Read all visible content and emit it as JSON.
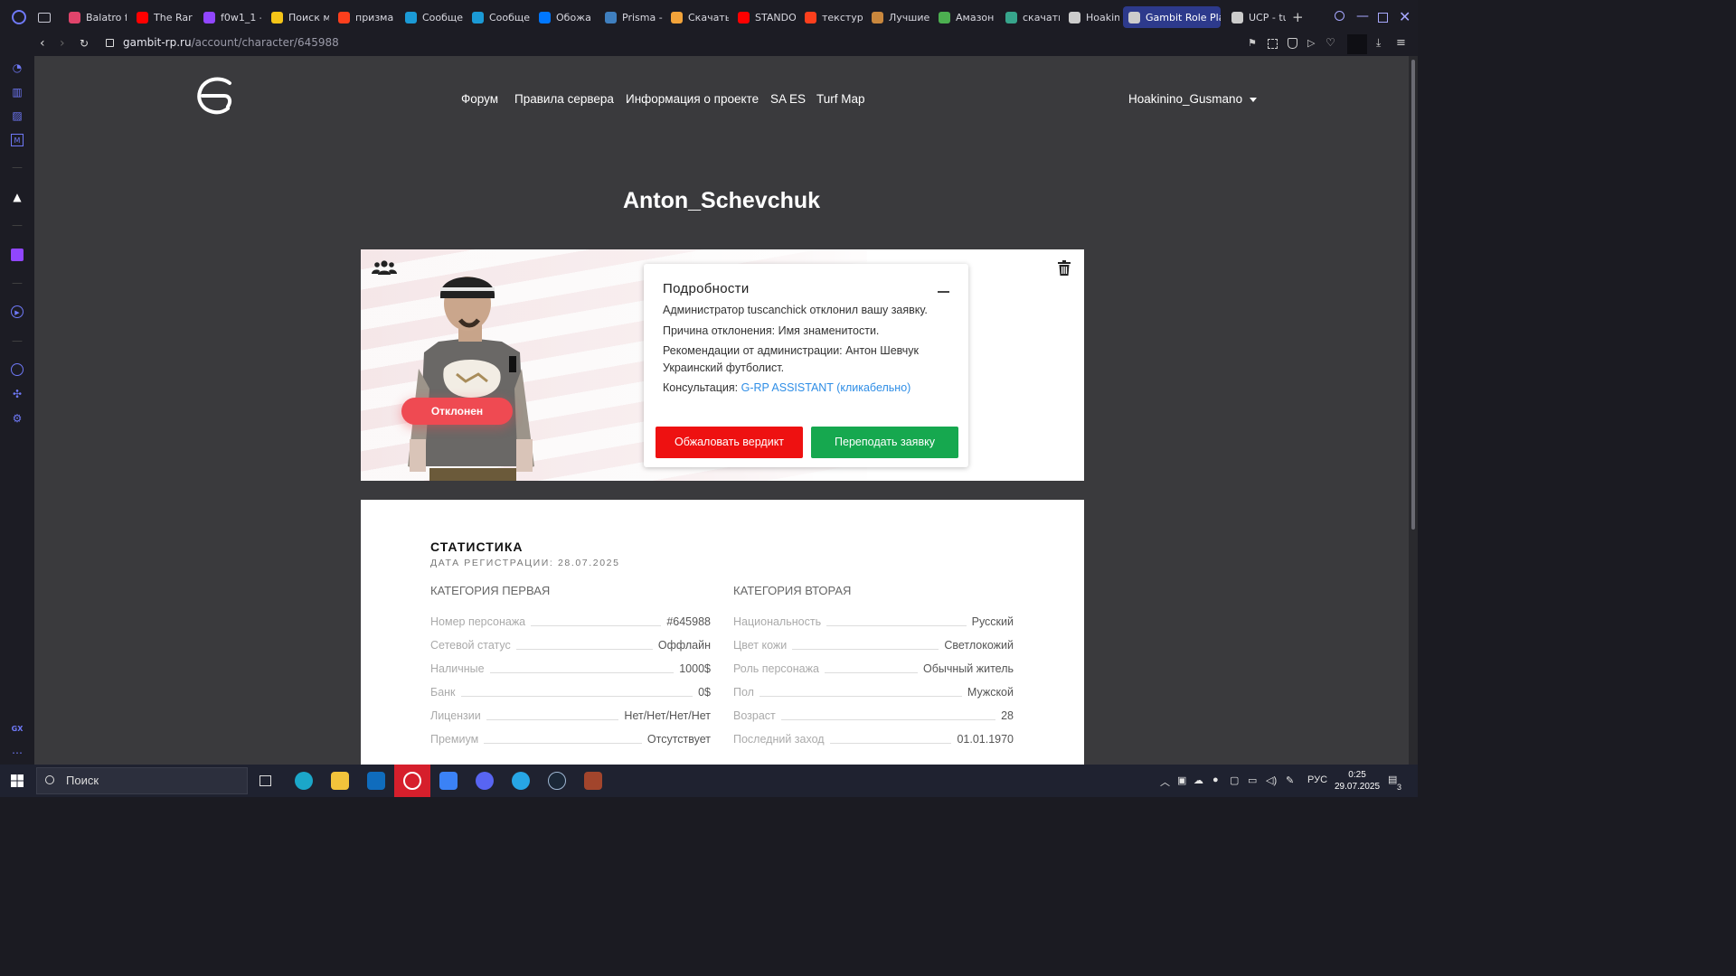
{
  "browser": {
    "tabs": [
      {
        "label": "Balatro f",
        "color": "#e0446b"
      },
      {
        "label": "The Rar",
        "color": "#ff0000"
      },
      {
        "label": "f0w1_1 -",
        "color": "#9146ff"
      },
      {
        "label": "Поиск м",
        "color": "#f5c518"
      },
      {
        "label": "призма",
        "color": "#fc3f1d"
      },
      {
        "label": "Сообще",
        "color": "#1b9ad6"
      },
      {
        "label": "Сообще",
        "color": "#1b9ad6"
      },
      {
        "label": "Обожа",
        "color": "#0077ff"
      },
      {
        "label": "Prisma -",
        "color": "#3f7fbf"
      },
      {
        "label": "Скачать",
        "color": "#f2a33a"
      },
      {
        "label": "STANDO",
        "color": "#ff0000"
      },
      {
        "label": "текстур",
        "color": "#fc3f1d"
      },
      {
        "label": "Лучшие",
        "color": "#c9873d"
      },
      {
        "label": "Амазон",
        "color": "#4caf50"
      },
      {
        "label": "скачать",
        "color": "#37a58c"
      },
      {
        "label": "Hoakini",
        "color": "#cccccc"
      },
      {
        "label": "Gambit Role Pla",
        "color": "#cccccc"
      },
      {
        "label": "UCP - tu",
        "color": "#cccccc"
      }
    ],
    "url_domain": "gambit-rp.ru",
    "url_path": "/account/character/645988"
  },
  "site": {
    "nav": [
      "Форум",
      "Правила сервера",
      "Информация о проекте",
      "SA ES",
      "Turf Map"
    ],
    "username": "Hoakinino_Gusmano"
  },
  "character": {
    "name": "Anton_Schevchuk",
    "status": "Отклонен",
    "accent_colors": {
      "rejected": "#ef4a52",
      "appeal": "#ee1111",
      "resubmit": "#16a84f",
      "link": "#2f8ee6"
    }
  },
  "details": {
    "title": "Подробности",
    "line1": "Администратор tuscanchick отклонил вашу заявку.",
    "line2": "Причина отклонения: Имя знаменитости.",
    "line3": "Рекомендации от администрации: Антон Шевчук Украинский футболист.",
    "consult_label": "Консультация:",
    "consult_link": "G-RP ASSISTANT (кликабельно)",
    "appeal_btn": "Обжаловать вердикт",
    "resubmit_btn": "Переподать заявку"
  },
  "stats": {
    "title": "СТАТИСТИКА",
    "registered": "ДАТА РЕГИСТРАЦИИ: 28.07.2025",
    "cat1_title": "КАТЕГОРИЯ ПЕРВАЯ",
    "cat2_title": "КАТЕГОРИЯ ВТОРАЯ",
    "cat1": [
      {
        "k": "Номер персонажа",
        "v": "#645988"
      },
      {
        "k": "Сетевой статус",
        "v": "Оффлайн"
      },
      {
        "k": "Наличные",
        "v": "1000$"
      },
      {
        "k": "Банк",
        "v": "0$"
      },
      {
        "k": "Лицензии",
        "v": "Нет/Нет/Нет/Нет"
      },
      {
        "k": "Премиум",
        "v": "Отсутствует"
      }
    ],
    "cat2": [
      {
        "k": "Национальность",
        "v": "Русский"
      },
      {
        "k": "Цвет кожи",
        "v": "Светлокожий"
      },
      {
        "k": "Роль персонажа",
        "v": "Обычный житель"
      },
      {
        "k": "Пол",
        "v": "Мужской"
      },
      {
        "k": "Возраст",
        "v": "28"
      },
      {
        "k": "Последний заход",
        "v": "01.01.1970"
      }
    ]
  },
  "taskbar": {
    "search_placeholder": "Поиск",
    "lang": "РУС",
    "time": "0:25",
    "date": "29.07.2025",
    "notif_count": "3"
  }
}
